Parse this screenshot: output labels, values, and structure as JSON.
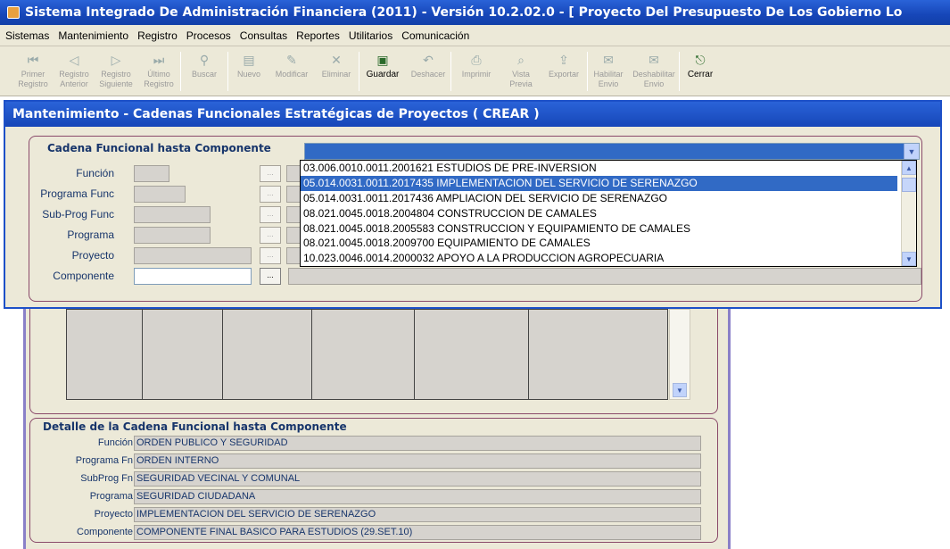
{
  "window": {
    "title": "Sistema Integrado De Administración Financiera (2011) - Versión 10.2.02.0 - [ Proyecto Del Presupuesto De Los Gobierno Lo"
  },
  "menu": [
    "Sistemas",
    "Mantenimiento",
    "Registro",
    "Procesos",
    "Consultas",
    "Reportes",
    "Utilitarios",
    "Comunicación"
  ],
  "toolbar": [
    {
      "label1": "Primer",
      "label2": "Registro",
      "icon": "first-record-icon",
      "glyph": "⏮",
      "active": false
    },
    {
      "label1": "Registro",
      "label2": "Anterior",
      "icon": "previous-record-icon",
      "glyph": "◁",
      "active": false
    },
    {
      "label1": "Registro",
      "label2": "Siguiente",
      "icon": "next-record-icon",
      "glyph": "▷",
      "active": false
    },
    {
      "label1": "Último",
      "label2": "Registro",
      "icon": "last-record-icon",
      "glyph": "⏭",
      "active": false
    },
    {
      "label1": "",
      "label2": "Buscar",
      "icon": "binoculars-icon",
      "glyph": "⚲",
      "active": false
    },
    {
      "label1": "",
      "label2": "Nuevo",
      "icon": "new-document-icon",
      "glyph": "▤",
      "active": false
    },
    {
      "label1": "",
      "label2": "Modificar",
      "icon": "edit-icon",
      "glyph": "✎",
      "active": false
    },
    {
      "label1": "",
      "label2": "Eliminar",
      "icon": "delete-icon",
      "glyph": "✕",
      "active": false
    },
    {
      "label1": "",
      "label2": "Guardar",
      "icon": "save-icon",
      "glyph": "▣",
      "active": true
    },
    {
      "label1": "",
      "label2": "Deshacer",
      "icon": "undo-icon",
      "glyph": "↶",
      "active": false
    },
    {
      "label1": "",
      "label2": "Imprimir",
      "icon": "printer-icon",
      "glyph": "⎙",
      "active": false
    },
    {
      "label1": "Vista",
      "label2": "Previa",
      "icon": "preview-icon",
      "glyph": "⌕",
      "active": false
    },
    {
      "label1": "",
      "label2": "Exportar",
      "icon": "export-icon",
      "glyph": "⇪",
      "active": false
    },
    {
      "label1": "Habilitar",
      "label2": "Envio",
      "icon": "enable-send-icon",
      "glyph": "✉",
      "active": false
    },
    {
      "label1": "Deshabilitar",
      "label2": "Envio",
      "icon": "disable-send-icon",
      "glyph": "✉",
      "active": false
    },
    {
      "label1": "",
      "label2": "Cerrar",
      "icon": "close-door-icon",
      "glyph": "⎋",
      "active": true
    }
  ],
  "dialog": {
    "title": "Mantenimiento - Cadenas Funcionales Estratégicas de Proyectos ( CREAR )",
    "frame_label": "Cadena Funcional hasta Componente",
    "combo_value": "",
    "fields": [
      {
        "label": "Función"
      },
      {
        "label": "Programa Func"
      },
      {
        "label": "Sub-Prog Func"
      },
      {
        "label": "Programa"
      },
      {
        "label": "Proyecto"
      },
      {
        "label": "Componente"
      }
    ],
    "dots_label": "..."
  },
  "dropdown": {
    "items": [
      "03.006.0010.0011.2001621 ESTUDIOS DE PRE-INVERSION",
      "05.014.0031.0011.2017435 IMPLEMENTACION DEL SERVICIO DE SERENAZGO",
      "05.014.0031.0011.2017436 AMPLIACION DEL SERVICIO DE SERENAZGO",
      "08.021.0045.0018.2004804 CONSTRUCCION DE CAMALES",
      "08.021.0045.0018.2005583 CONSTRUCCION Y EQUIPAMIENTO DE CAMALES",
      "08.021.0045.0018.2009700 EQUIPAMIENTO DE CAMALES",
      "10.023.0046.0014.2000032 APOYO A LA PRODUCCION AGROPECUARIA"
    ],
    "selected_index": 1
  },
  "detail": {
    "title": "Detalle de la Cadena Funcional hasta Componente",
    "rows": [
      {
        "label": "Función",
        "value": "ORDEN PUBLICO Y SEGURIDAD"
      },
      {
        "label": "Programa Fn",
        "value": "ORDEN INTERNO"
      },
      {
        "label": "SubProg Fn",
        "value": "SEGURIDAD VECINAL Y COMUNAL"
      },
      {
        "label": "Programa",
        "value": "SEGURIDAD CIUDADANA"
      },
      {
        "label": "Proyecto",
        "value": "IMPLEMENTACION DEL SERVICIO DE SERENAZGO"
      },
      {
        "label": "Componente",
        "value": "COMPONENTE FINAL BASICO PARA ESTUDIOS (29.SET.10)"
      }
    ]
  },
  "colors": {
    "title_bar": "#1646b8",
    "selection": "#316ac5",
    "window_bg": "#ece9d8",
    "label_text": "#17356b"
  }
}
